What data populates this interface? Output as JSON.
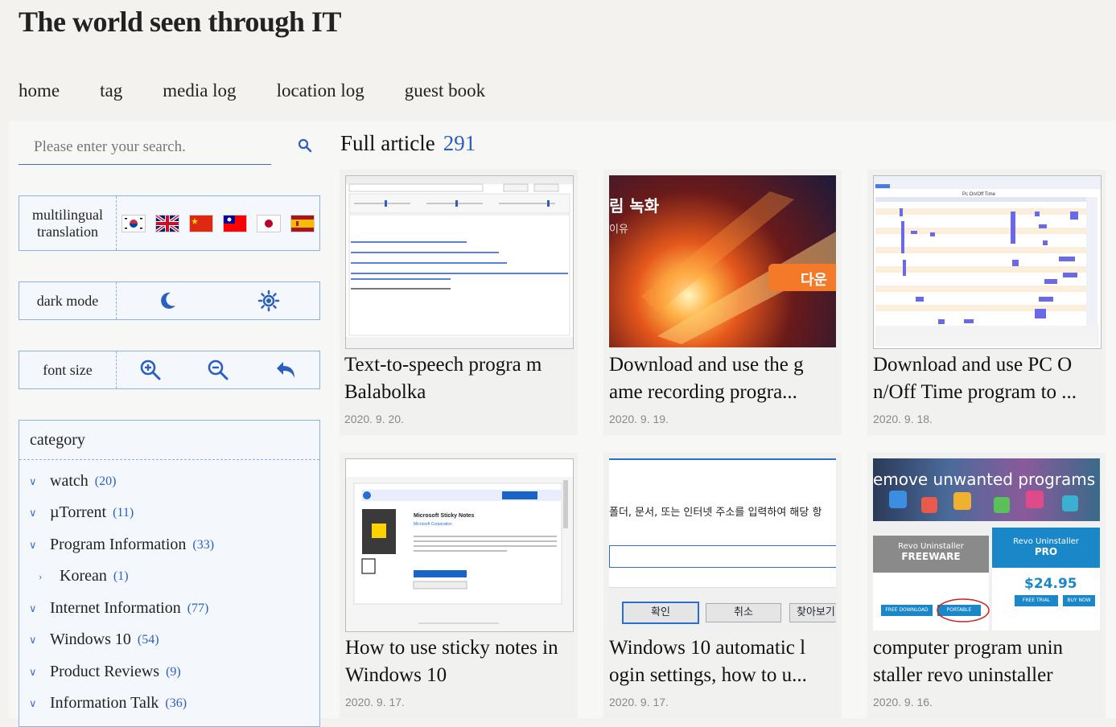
{
  "site": {
    "title": "The world seen through IT"
  },
  "nav": [
    "home",
    "tag",
    "media log",
    "location log",
    "guest book"
  ],
  "search": {
    "placeholder": "Please enter your search."
  },
  "sidebar": {
    "translation_label": "multilingual translation",
    "dark_mode_label": "dark mode",
    "font_size_label": "font size",
    "category_label": "category",
    "categories": [
      {
        "name": "watch",
        "count": "(20)"
      },
      {
        "name": "µTorrent",
        "count": "(11)"
      },
      {
        "name": "Program Information",
        "count": "(33)"
      },
      {
        "name": "Korean",
        "count": "(1)"
      },
      {
        "name": "Internet Information",
        "count": "(77)"
      },
      {
        "name": "Windows 10",
        "count": "(54)"
      },
      {
        "name": "Product Reviews",
        "count": "(9)"
      },
      {
        "name": "Information Talk",
        "count": "(36)"
      }
    ]
  },
  "main": {
    "heading": "Full article",
    "count": "291",
    "articles": [
      {
        "title": "Text-to-speech progra m Balabolka",
        "date": "2020. 9. 20."
      },
      {
        "title": "Download and use the g ame recording progra...",
        "date": "2020. 9. 19."
      },
      {
        "title": "Download and use PC O n/Off Time program to ...",
        "date": "2020. 9. 18."
      },
      {
        "title": "How to use sticky notes in Windows 10",
        "date": "2020. 9. 17."
      },
      {
        "title": "Windows 10 automatic l ogin settings, how to u...",
        "date": "2020. 9. 17."
      },
      {
        "title": "computer program unin staller revo uninstaller",
        "date": "2020. 9. 16."
      }
    ],
    "thumb_text": {
      "game_recording": "림 녹화",
      "game_recording_sub": "이유",
      "game_download": "다운",
      "login_text": "폴더, 문서, 또는 인터넷 주소를 입력하여 해당 항",
      "login_ok": "확인",
      "login_cancel": "취소",
      "login_browse": "찾아보기",
      "revo_banner": "emove unwanted programs",
      "revo_free_name": "Revo Uninstaller",
      "revo_free_tier": "FREEWARE",
      "revo_pro_name": "Revo Uninstaller",
      "revo_pro_tier": "PRO",
      "revo_price": "$24.95",
      "revo_free_download": "FREE DOWNLOAD",
      "revo_portable": "PORTABLE",
      "revo_trial": "FREE TRIAL",
      "revo_buy": "BUY NOW",
      "pc_onoff_title": "Pc On/Off Time",
      "sticky_app": "Microsoft Sticky Notes",
      "sticky_vendor": "Microsoft Corporation"
    }
  },
  "colors": {
    "accent": "#2a5fbf",
    "border": "#8fb0e6"
  }
}
